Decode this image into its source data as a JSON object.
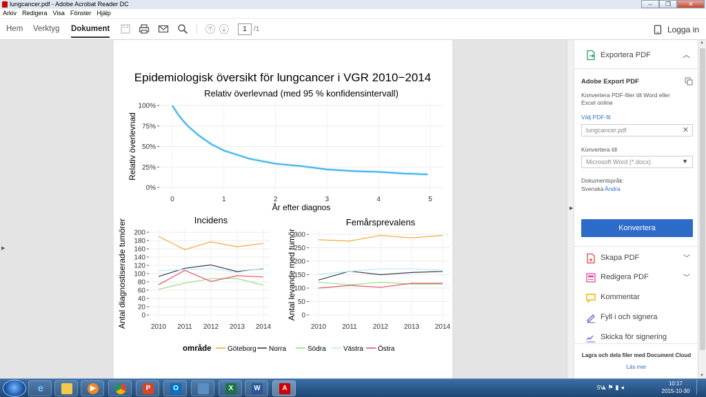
{
  "window": {
    "title": "lungcancer.pdf - Adobe Acrobat Reader DC"
  },
  "menu": [
    "Arkiv",
    "Redigera",
    "Visa",
    "Fönster",
    "Hjälp"
  ],
  "toolbar": {
    "tabs": [
      "Hem",
      "Verktyg",
      "Dokument"
    ],
    "page_current": "1",
    "page_total": "/1",
    "login": "Logga in"
  },
  "document": {
    "main_title": "Epidemiologisk översikt för lungcancer i VGR 2010−2014",
    "legend_title": "område"
  },
  "chart_data": [
    {
      "type": "line",
      "title": "Relativ överlevnad (med 95 % konfidensintervall)",
      "xlabel": "År efter diagnos",
      "ylabel": "Relativ överlevnad",
      "xlim": [
        0,
        5
      ],
      "ylim": [
        0,
        100
      ],
      "x_ticks": [
        "0",
        "1",
        "2",
        "3",
        "4",
        "5"
      ],
      "y_ticks": [
        "0%",
        "25%",
        "50%",
        "75%",
        "100%"
      ],
      "series": [
        {
          "color": "#29aee8",
          "x": [
            0,
            0.1,
            0.2,
            0.3,
            0.5,
            0.75,
            1.0,
            1.25,
            1.5,
            2.0,
            2.5,
            3.0,
            3.5,
            4.0,
            4.5,
            4.95
          ],
          "y": [
            100,
            90,
            82,
            75,
            64,
            53,
            45,
            40,
            35,
            29,
            26,
            22,
            20,
            19,
            17,
            16
          ]
        }
      ]
    },
    {
      "type": "line",
      "title": "Incidens",
      "ylabel": "Antal diagnostiserade tumörer",
      "categories": [
        "2010",
        "2011",
        "2012",
        "2013",
        "2014"
      ],
      "ylim": [
        0,
        200
      ],
      "y_ticks": [
        "0",
        "20",
        "40",
        "60",
        "80",
        "100",
        "120",
        "140",
        "160",
        "180",
        "200"
      ],
      "series": [
        {
          "name": "Göteborg",
          "color": "#f0a830",
          "values": [
            190,
            158,
            177,
            165,
            173
          ]
        },
        {
          "name": "Norra",
          "color": "#3a3a4a",
          "values": [
            93,
            113,
            121,
            105,
            112
          ]
        },
        {
          "name": "Södra",
          "color": "#8fe07c",
          "values": [
            62,
            77,
            88,
            88,
            72
          ]
        },
        {
          "name": "Västra",
          "color": "#b6ecf0",
          "values": [
            107,
            110,
            112,
            103,
            113
          ]
        },
        {
          "name": "Östra",
          "color": "#e8506a",
          "values": [
            73,
            108,
            81,
            95,
            92
          ]
        }
      ]
    },
    {
      "type": "line",
      "title": "Femårsprevalens",
      "ylabel": "Antal levande med tumör",
      "categories": [
        "2010",
        "2011",
        "2012",
        "2013",
        "2014"
      ],
      "ylim": [
        0,
        300
      ],
      "y_ticks": [
        "0",
        "50",
        "100",
        "150",
        "200",
        "250",
        "300"
      ],
      "series": [
        {
          "name": "Göteborg",
          "color": "#f0a830",
          "values": [
            280,
            275,
            296,
            287,
            296
          ]
        },
        {
          "name": "Norra",
          "color": "#3a3a4a",
          "values": [
            130,
            163,
            150,
            158,
            162
          ]
        },
        {
          "name": "Södra",
          "color": "#8fe07c",
          "values": [
            122,
            112,
            122,
            115,
            115
          ]
        },
        {
          "name": "Västra",
          "color": "#b6ecf0",
          "values": [
            152,
            162,
            172,
            172,
            167
          ]
        },
        {
          "name": "Östra",
          "color": "#e8506a",
          "values": [
            100,
            110,
            103,
            118,
            118
          ]
        }
      ]
    }
  ],
  "right_panel": {
    "export_title": "Exportera PDF",
    "adobe_export": "Adobe Export PDF",
    "desc_line1": "Konvertera PDF-filer till Word eller",
    "desc_line2": "Excel online",
    "select_pdf": "Välj PDF-fil",
    "file_name": "lungcancer.pdf",
    "convert_to_label": "Konvertera till",
    "convert_to_value": "Microsoft Word (*.docx)",
    "doc_lang_label": "Dokumentspråk:",
    "doc_lang_value": "Svenska",
    "change": "Ändra",
    "convert_button": "Konvertera",
    "tools": [
      {
        "label": "Skapa PDF",
        "color": "#e04646"
      },
      {
        "label": "Redigera PDF",
        "color": "#d94fa0"
      },
      {
        "label": "Kommentar",
        "color": "#f0b400"
      },
      {
        "label": "Fyll i och signera",
        "color": "#6a5bd6"
      },
      {
        "label": "Skicka för signering",
        "color": "#6a5bd6"
      }
    ],
    "cloud_text": "Lagra och dela filer med Document Cloud",
    "read_more": "Läs mer"
  },
  "taskbar": {
    "lang": "SV",
    "time": "10:17",
    "date": "2015-10-30",
    "apps": [
      "ie",
      "explorer",
      "media-player",
      "chrome",
      "powerpoint",
      "outlook",
      "file-manager",
      "excel",
      "word",
      "acrobat"
    ]
  }
}
